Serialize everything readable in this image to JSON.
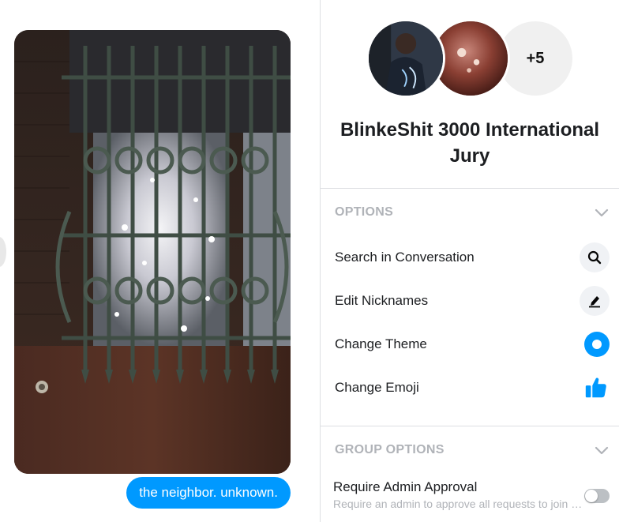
{
  "chat": {
    "message_text": "the neighbor. unknown.",
    "photo_alt": "photo"
  },
  "panel": {
    "more_members": "+5",
    "group_title": "BlinkeShit 3000 International Jury",
    "options_section": {
      "label": "OPTIONS",
      "items": [
        {
          "label": "Search in Conversation",
          "icon": "search-icon"
        },
        {
          "label": "Edit Nicknames",
          "icon": "edit-icon"
        },
        {
          "label": "Change Theme",
          "icon": "theme-icon"
        },
        {
          "label": "Change Emoji",
          "icon": "thumbs-up-icon"
        }
      ]
    },
    "group_options_section": {
      "label": "GROUP OPTIONS",
      "require_admin": {
        "title": "Require Admin Approval",
        "description": "Require an admin to approve all requests to join the group",
        "enabled": false
      }
    }
  },
  "colors": {
    "accent": "#0099ff",
    "section_label": "#b0b3b8",
    "divider": "#dddfe2"
  }
}
